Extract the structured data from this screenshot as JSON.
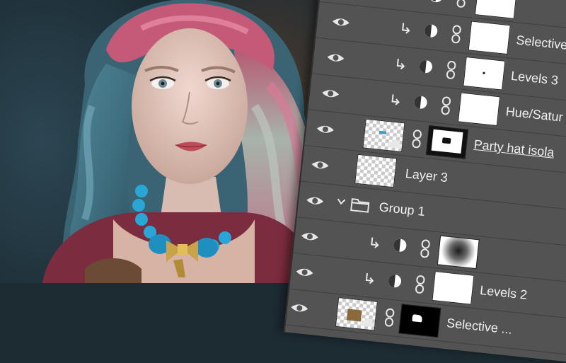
{
  "layers_panel": {
    "layers": [
      {
        "name": "",
        "kind": "adjustment",
        "clipped": false
      },
      {
        "name": "Selective",
        "kind": "adjustment",
        "clipped": true
      },
      {
        "name": "Levels 3",
        "kind": "adjustment",
        "clipped": true
      },
      {
        "name": "Hue/Satur",
        "kind": "adjustment",
        "clipped": true
      },
      {
        "name": "Party hat isola",
        "kind": "smart-object",
        "clipped": false
      },
      {
        "name": "Layer 3",
        "kind": "pixel",
        "clipped": false
      },
      {
        "name": "Group 1",
        "kind": "group",
        "expanded": true
      },
      {
        "name": "",
        "kind": "adjustment",
        "clipped": true
      },
      {
        "name": "Levels 2",
        "kind": "adjustment",
        "clipped": true
      },
      {
        "name": "Selective ...",
        "kind": "smart-object",
        "clipped": false
      }
    ]
  },
  "icons": {
    "visibility": "eye-icon",
    "clipping": "clipping-arrow-icon",
    "adjustment": "half-circle-adjustment-icon",
    "link": "chain-link-icon",
    "group": "folder-icon"
  },
  "colors": {
    "panel_bg": "#535353",
    "panel_divider": "#3f3f3f",
    "text": "#f0f0f0",
    "hair_pink": "#c4607a",
    "hair_teal": "#5b8fa0",
    "necklace": "#2aa6d6",
    "bow_gold": "#c9a34a"
  }
}
